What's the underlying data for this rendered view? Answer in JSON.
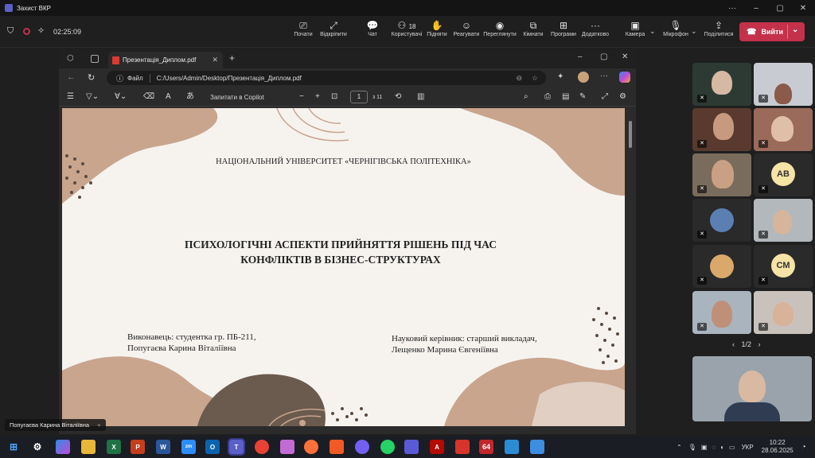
{
  "window": {
    "title": "Захист ВКР"
  },
  "meeting": {
    "timer": "02:25:09",
    "toolbar": {
      "start": "Почати",
      "unpin": "Відкріпити",
      "chat": "Чат",
      "people": "Користувачі",
      "people_count": "18",
      "raise": "Підняти",
      "react": "Реагувати",
      "view": "Переглянути",
      "rooms": "Кімнати",
      "apps": "Програми",
      "more": "Додатково",
      "camera": "Камера",
      "mic": "Мікрофон",
      "share": "Поділитися",
      "leave": "Вийти"
    },
    "presenter_name": "Попугаєва Карина Віталіївна",
    "pager": "1/2",
    "participants_initials": [
      "AB",
      "CM"
    ]
  },
  "browser": {
    "tab_title": "Презентація_Диплом.pdf",
    "url_label": "Файл",
    "url": "C:/Users/Admin/Desktop/Презентація_Диплом.pdf",
    "copilot": "Запитати в Copilot",
    "page_current": "1",
    "page_total": "з 11"
  },
  "slide": {
    "university": "НАЦІОНАЛЬНИЙ УНІВЕРСИТЕТ «ЧЕРНІГІВСЬКА ПОЛІТЕХНІКА»",
    "title_line1": "ПСИХОЛОГІЧНІ АСПЕКТИ ПРИЙНЯТТЯ РІШЕНЬ ПІД ЧАС",
    "title_line2": "КОНФЛІКТІВ В БІЗНЕС-СТРУКТУРАХ",
    "author_line1": "Виконавець: студентка гр. ПБ-211,",
    "author_line2": "Попугаєва Карина Віталіївна",
    "advisor_line1": "Науковий керівник: старший викладач,",
    "advisor_line2": "Лещенко Марина Євгеніївна"
  },
  "taskbar": {
    "lang": "УКР",
    "time": "10:22",
    "date": "28.06.2025"
  },
  "colors": {
    "teams_purple": "#5b5fc7",
    "leave_red": "#c4314b",
    "slide_bg": "#f6f3ef",
    "shape_tan": "#c9a58e",
    "shape_brown": "#6b5a4e"
  }
}
